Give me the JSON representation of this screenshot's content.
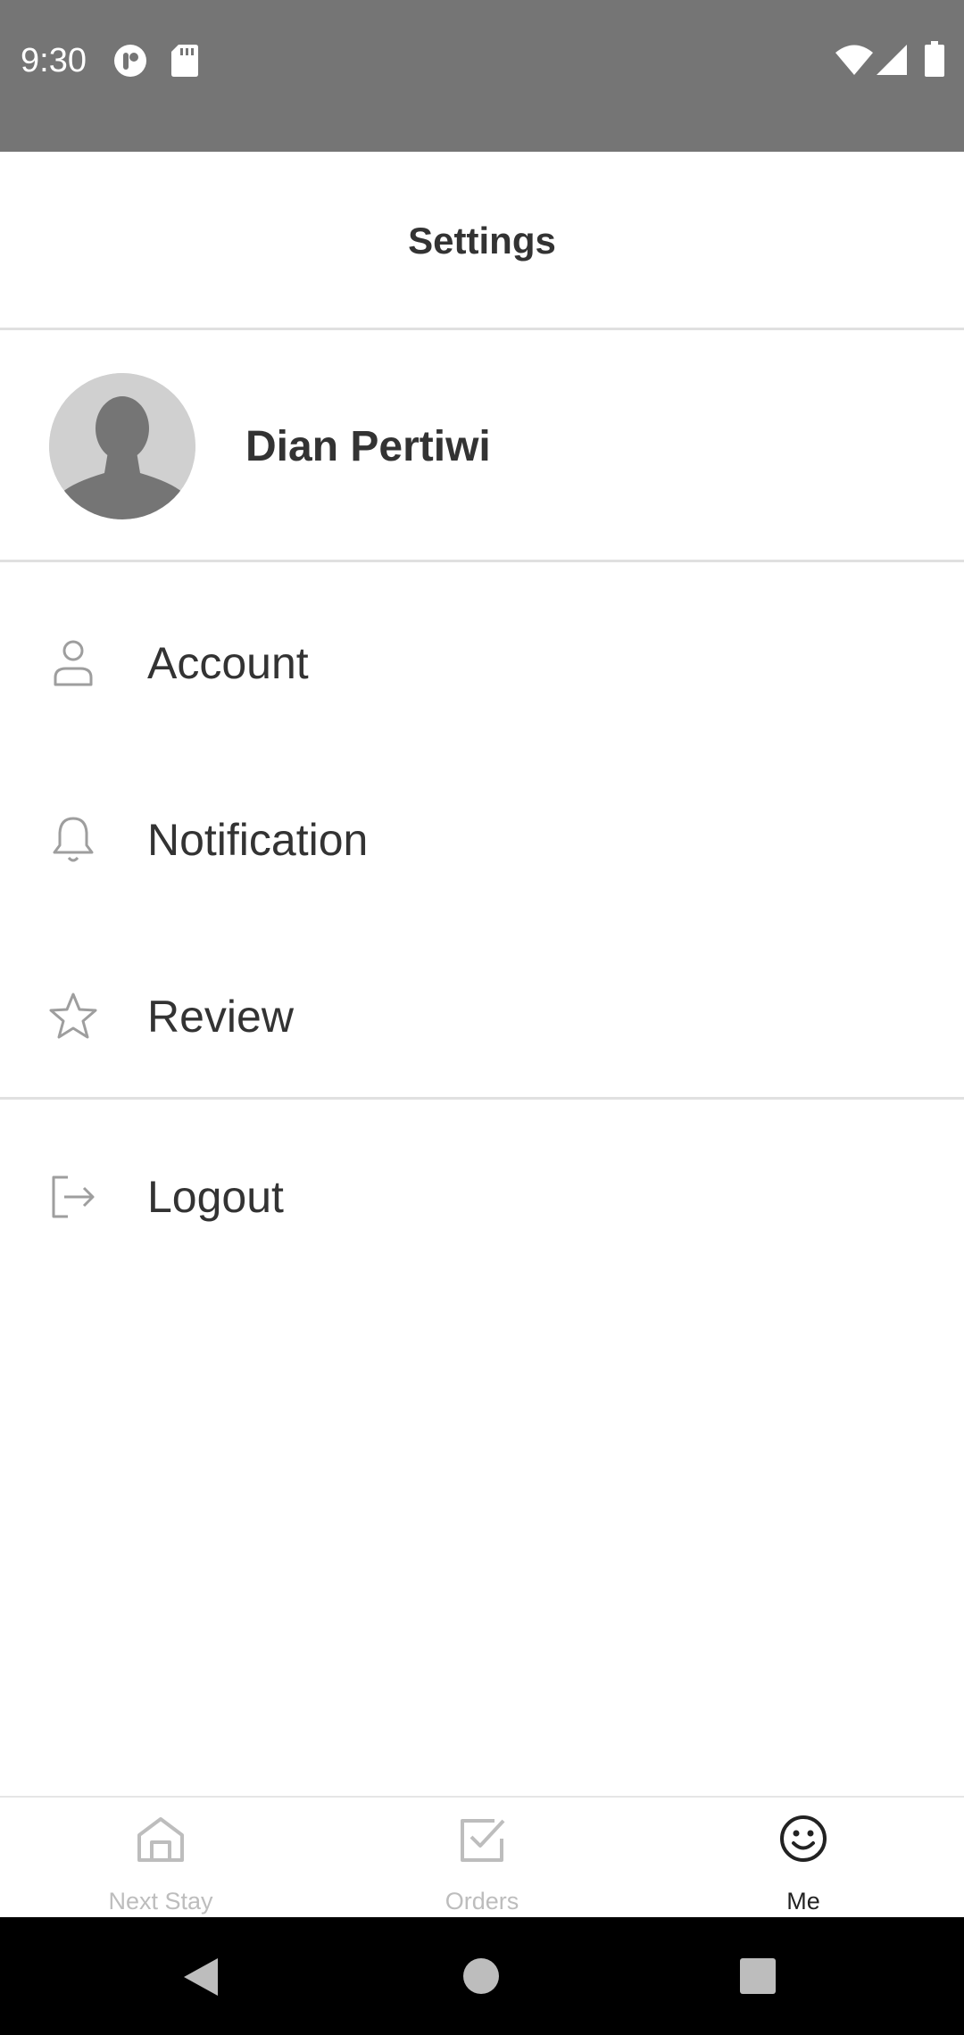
{
  "status_bar": {
    "time": "9:30",
    "icons": [
      "pocket-casts-icon",
      "sd-card-icon",
      "wifi-icon",
      "cellular-signal-icon",
      "battery-icon"
    ],
    "background": "#757575"
  },
  "header": {
    "title": "Settings"
  },
  "profile": {
    "name": "Dian Pertiwi",
    "avatar_icon": "default-avatar-icon"
  },
  "menu": {
    "items": [
      {
        "label": "Account",
        "icon": "person-icon"
      },
      {
        "label": "Notification",
        "icon": "bell-icon"
      },
      {
        "label": "Review",
        "icon": "star-icon"
      },
      {
        "label": "Logout",
        "icon": "logout-icon"
      }
    ]
  },
  "bottom_nav": {
    "tabs": [
      {
        "label": "Next Stay",
        "icon": "home-icon",
        "active": false
      },
      {
        "label": "Orders",
        "icon": "checkbox-icon",
        "active": false
      },
      {
        "label": "Me",
        "icon": "smiley-icon",
        "active": true
      }
    ],
    "active_color": "#222222",
    "inactive_color": "#bdbdbd"
  },
  "system_nav": {
    "buttons": [
      "back-icon",
      "home-circle-icon",
      "recents-icon"
    ]
  }
}
